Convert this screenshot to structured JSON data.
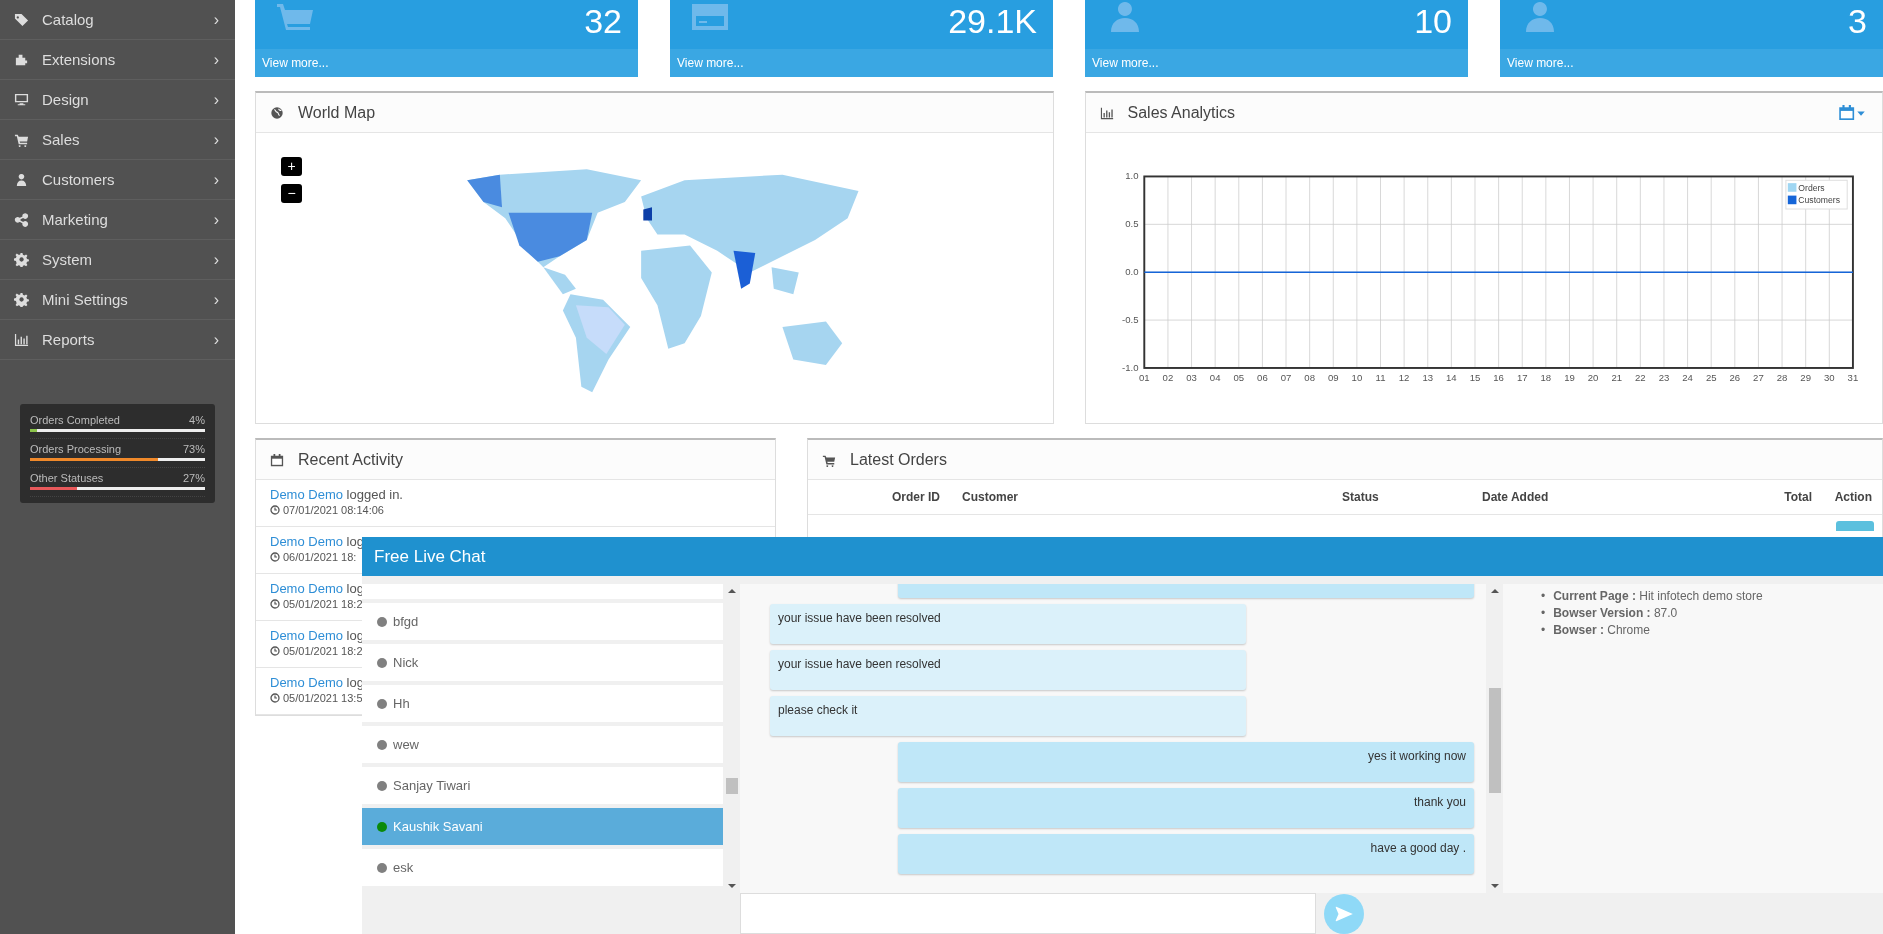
{
  "sidebar": {
    "items": [
      {
        "label": "Catalog",
        "chevron": "›"
      },
      {
        "label": "Extensions",
        "chevron": "›"
      },
      {
        "label": "Design",
        "chevron": "›"
      },
      {
        "label": "Sales",
        "chevron": "›"
      },
      {
        "label": "Customers",
        "chevron": "›"
      },
      {
        "label": "Marketing",
        "chevron": "›"
      },
      {
        "label": "System",
        "chevron": "›"
      },
      {
        "label": "Mini Settings",
        "chevron": "›"
      },
      {
        "label": "Reports",
        "chevron": "›"
      }
    ]
  },
  "order_status": [
    {
      "label": "Orders Completed",
      "reading": "4%",
      "level": 0.04,
      "color": "#8bc34a"
    },
    {
      "label": "Orders Processing",
      "reading": "73%",
      "level": 0.73,
      "color": "#f0892a"
    },
    {
      "label": "Other Statuses",
      "reading": "27%",
      "level": 0.27,
      "color": "#e8595b"
    }
  ],
  "tiles": [
    {
      "value": "32",
      "link": "View more..."
    },
    {
      "value": "29.1K",
      "link": "View more..."
    },
    {
      "value": "10",
      "link": "View more..."
    },
    {
      "value": "3",
      "link": "View more..."
    }
  ],
  "world_map": {
    "title": "World Map",
    "zoom_in": "+",
    "zoom_out": "−"
  },
  "sales_analytics": {
    "title": "Sales Analytics",
    "chart_data": {
      "type": "line",
      "categories": [
        "01",
        "02",
        "03",
        "04",
        "05",
        "06",
        "07",
        "08",
        "09",
        "10",
        "11",
        "12",
        "13",
        "14",
        "15",
        "16",
        "17",
        "18",
        "19",
        "20",
        "21",
        "22",
        "23",
        "24",
        "25",
        "26",
        "27",
        "28",
        "29",
        "30",
        "31"
      ],
      "ylim": [
        -1,
        1
      ],
      "grid": true,
      "legend": true,
      "yticks": [
        {
          "value": -1,
          "label": "-1.0"
        },
        {
          "value": -0.5,
          "label": "-0.5"
        },
        {
          "value": 0,
          "label": "0.0"
        },
        {
          "value": 0.5,
          "label": "0.5"
        },
        {
          "value": 1,
          "label": "1.0"
        }
      ],
      "series": [
        {
          "name": "Orders",
          "color": "#9fd6f2",
          "values": [
            null,
            null,
            null,
            null,
            null,
            null,
            null,
            null,
            null,
            null,
            null,
            null,
            null,
            null,
            null,
            null,
            null,
            null,
            null,
            null,
            null,
            null,
            null,
            null,
            null,
            null,
            null,
            null,
            null,
            null,
            null
          ]
        },
        {
          "name": "Customers",
          "color": "#1565d8",
          "values": [
            0,
            0,
            0,
            0,
            0,
            0,
            0,
            0,
            0,
            0,
            0,
            0,
            0,
            0,
            0,
            0,
            0,
            0,
            0,
            0,
            0,
            0,
            0,
            0,
            0,
            0,
            0,
            0,
            0,
            0,
            0
          ]
        }
      ]
    }
  },
  "recent_activity": {
    "title": "Recent Activity",
    "items": [
      {
        "user": "Demo Demo",
        "action": "logged in.",
        "time": "07/01/2021 08:14:06"
      },
      {
        "user": "Demo Demo",
        "action": "log",
        "time": "06/01/2021 18:"
      },
      {
        "user": "Demo Demo",
        "action": "log",
        "time": "05/01/2021 18:2"
      },
      {
        "user": "Demo Demo",
        "action": "log",
        "time": "05/01/2021 18:2"
      },
      {
        "user": "Demo Demo",
        "action": "log",
        "time": "05/01/2021 13:5"
      }
    ]
  },
  "latest_orders": {
    "title": "Latest Orders",
    "columns": [
      "Order ID",
      "Customer",
      "Status",
      "Date Added",
      "Total",
      "Action"
    ]
  },
  "chat": {
    "title": "Free Live Chat",
    "users": [
      {
        "name": "bfgd",
        "online": false,
        "selected": false
      },
      {
        "name": "Nick",
        "online": false,
        "selected": false
      },
      {
        "name": "Hh",
        "online": false,
        "selected": false
      },
      {
        "name": "wew",
        "online": false,
        "selected": false
      },
      {
        "name": "Sanjay Tiwari",
        "online": false,
        "selected": false
      },
      {
        "name": "Kaushik Savani",
        "online": true,
        "selected": true
      },
      {
        "name": "esk",
        "online": false,
        "selected": false
      }
    ],
    "messages": [
      {
        "kind": "sent"
      },
      {
        "kind": "received",
        "text": "your issue have been resolved"
      },
      {
        "kind": "received",
        "text": "your issue have been resolved"
      },
      {
        "kind": "received",
        "text": "please check it"
      },
      {
        "kind": "sent",
        "text": "yes it working now"
      },
      {
        "kind": "sent",
        "text": "thank you"
      },
      {
        "kind": "sent",
        "text": "have a good day ."
      }
    ],
    "visitor_info": [
      {
        "marker": "•",
        "text": "**Current Page :** Hit infotech demo store"
      },
      {
        "marker": "•",
        "text": "**Bowser Version :** 87.0"
      },
      {
        "marker": "•",
        "text": "**Bowser :** Chrome"
      }
    ]
  }
}
